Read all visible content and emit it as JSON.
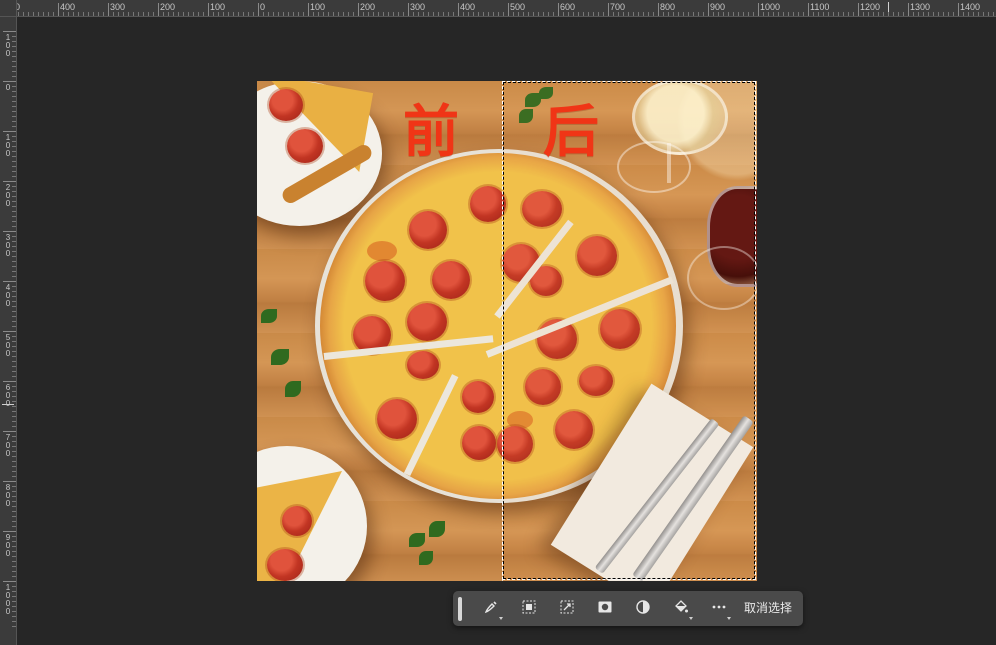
{
  "ruler": {
    "top_labels": [
      "00",
      "400",
      "300",
      "200",
      "100",
      "0",
      "100",
      "200",
      "300",
      "400",
      "500",
      "600",
      "700",
      "800",
      "900",
      "1000",
      "1100",
      "1200",
      "1300",
      "1400"
    ],
    "left_labels": [
      "100",
      "0",
      "100",
      "200",
      "300",
      "400",
      "500",
      "600",
      "700",
      "800",
      "900",
      "1000"
    ]
  },
  "canvas": {
    "label_before": "前",
    "label_after": "后"
  },
  "taskbar": {
    "buttons": [
      {
        "icon": "brush-selection-icon"
      },
      {
        "icon": "select-subject-icon"
      },
      {
        "icon": "transform-selection-icon"
      },
      {
        "icon": "layer-mask-icon"
      },
      {
        "icon": "adjustment-icon"
      },
      {
        "icon": "fill-icon"
      },
      {
        "icon": "more-options-icon"
      }
    ],
    "deselect_label": "取消选择"
  },
  "colors": {
    "workspace": "#262626",
    "ruler": "#3b3b3b",
    "taskbar": "#4a4a4a",
    "label_red": "#f03516"
  }
}
